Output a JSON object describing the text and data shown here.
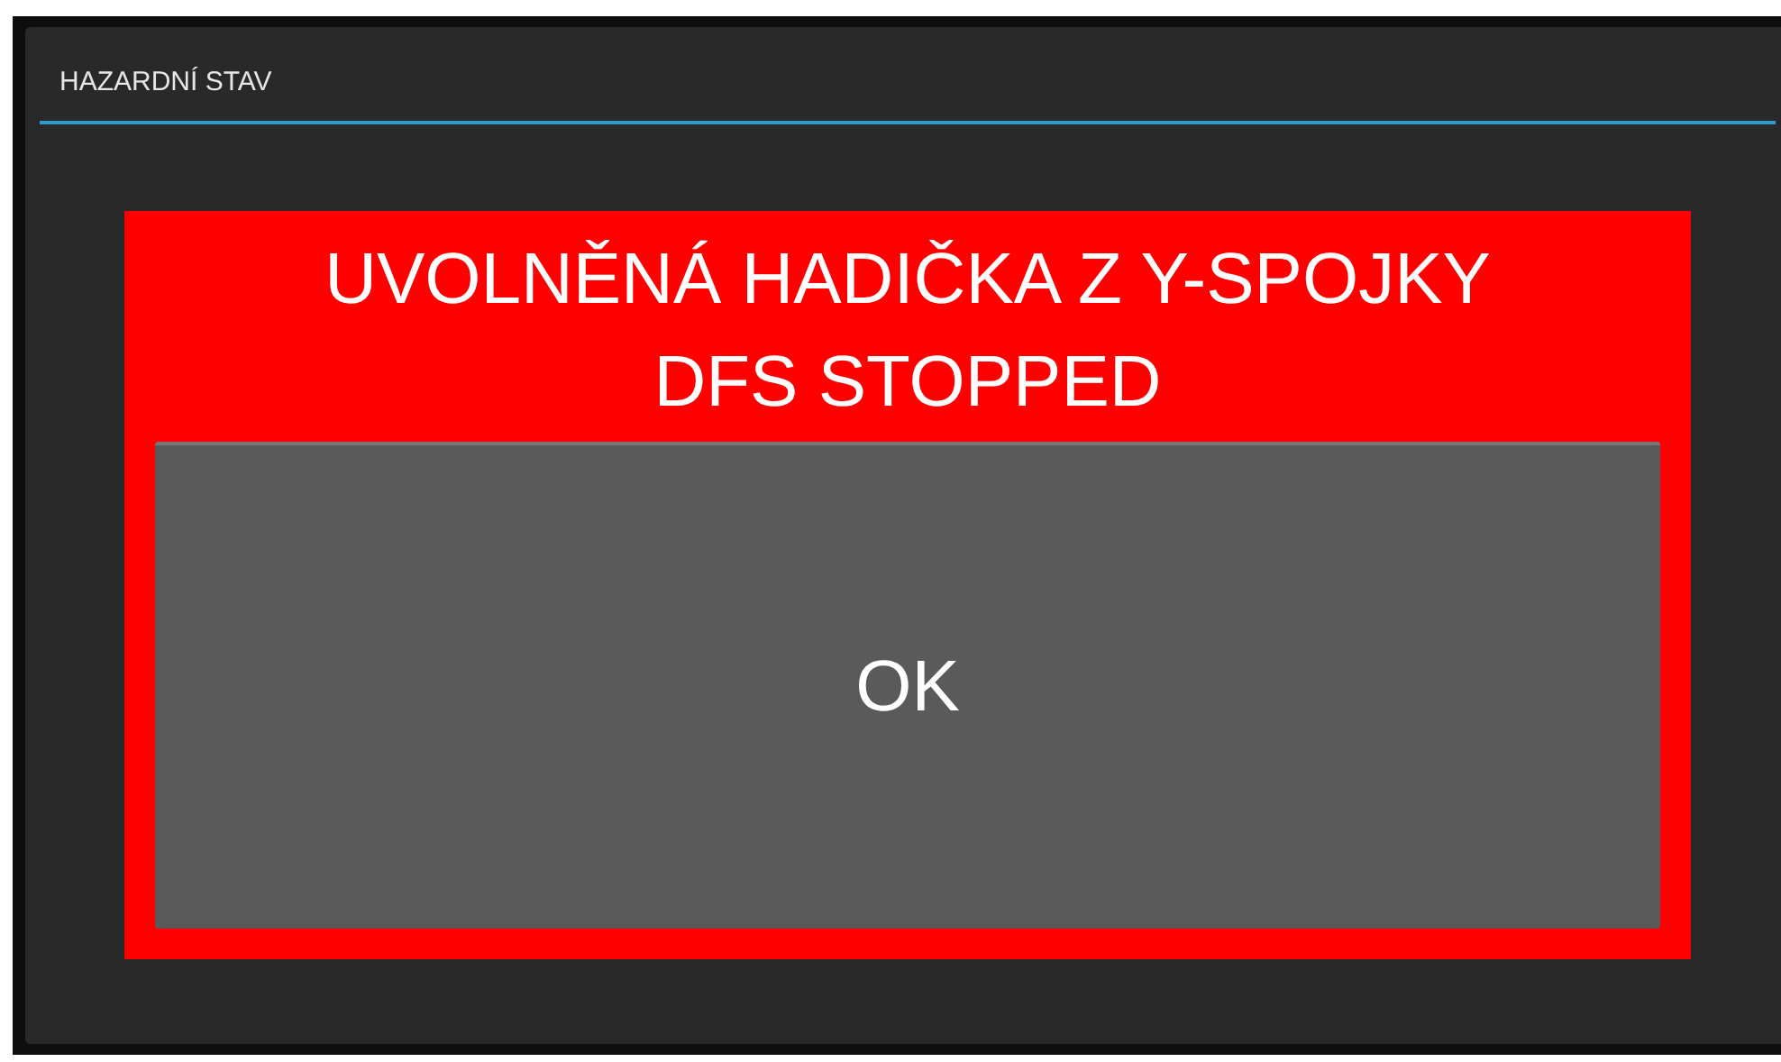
{
  "dialog": {
    "title": "HAZARDNÍ STAV"
  },
  "alarm": {
    "lines": [
      "UVOLNĚNÁ HADIČKA Z Y-SPOJKY",
      "DFS STOPPED"
    ]
  },
  "buttons": [
    "OK"
  ]
}
